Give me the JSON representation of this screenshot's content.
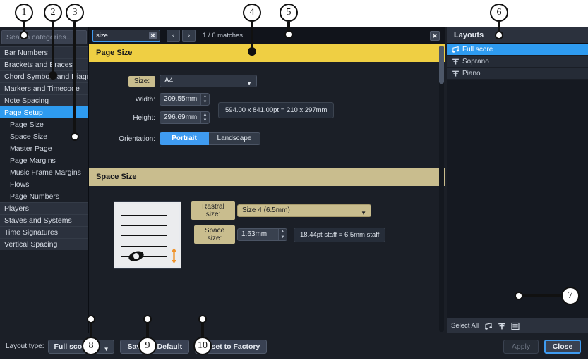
{
  "sidebar": {
    "search_placeholder": "Search categories...",
    "categories": [
      {
        "label": "Bar Numbers",
        "selected": false,
        "sub": false
      },
      {
        "label": "Brackets and Braces",
        "selected": false,
        "sub": false
      },
      {
        "label": "Chord Symbols and Diagrams",
        "selected": false,
        "sub": false
      },
      {
        "label": "Markers and Timecode",
        "selected": false,
        "sub": false
      },
      {
        "label": "Note Spacing",
        "selected": false,
        "sub": false
      },
      {
        "label": "Page Setup",
        "selected": true,
        "sub": false
      },
      {
        "label": "Page Size",
        "selected": false,
        "sub": true
      },
      {
        "label": "Space Size",
        "selected": false,
        "sub": true
      },
      {
        "label": "Master Page",
        "selected": false,
        "sub": true
      },
      {
        "label": "Page Margins",
        "selected": false,
        "sub": true
      },
      {
        "label": "Music Frame Margins",
        "selected": false,
        "sub": true
      },
      {
        "label": "Flows",
        "selected": false,
        "sub": true
      },
      {
        "label": "Page Numbers",
        "selected": false,
        "sub": true
      },
      {
        "label": "Players",
        "selected": false,
        "sub": false
      },
      {
        "label": "Staves and Systems",
        "selected": false,
        "sub": false
      },
      {
        "label": "Time Signatures",
        "selected": false,
        "sub": false
      },
      {
        "label": "Vertical Spacing",
        "selected": false,
        "sub": false
      }
    ]
  },
  "findbar": {
    "query": "size",
    "clear_label": "✖",
    "prev_label": "‹",
    "next_label": "›",
    "matches": "1 / 6 matches",
    "close_label": "✖"
  },
  "page_size": {
    "header": "Page Size",
    "size_label": "Size:",
    "size_value": "A4",
    "width_label": "Width:",
    "width_value": "209.55mm",
    "height_label": "Height:",
    "height_value": "296.69mm",
    "dimensions_info": "594.00 x 841.00pt = 210 x 297mm",
    "orientation_label": "Orientation:",
    "orientation_portrait": "Portrait",
    "orientation_landscape": "Landscape",
    "orientation_selected": "Portrait"
  },
  "space_size": {
    "header": "Space Size",
    "rastral_label": "Rastral size:",
    "rastral_value": "Size 4 (6.5mm)",
    "space_label": "Space size:",
    "space_value": "1.63mm",
    "staff_info": "18.44pt staff = 6.5mm staff",
    "thumbnail_icon": "staff-space-size-icon"
  },
  "layouts": {
    "title": "Layouts",
    "items": [
      {
        "label": "Full score",
        "icon": "score-icon",
        "selected": true
      },
      {
        "label": "Soprano",
        "icon": "player-icon",
        "selected": false
      },
      {
        "label": "Piano",
        "icon": "player-icon",
        "selected": false
      }
    ],
    "select_all_label": "Select All",
    "filters": [
      {
        "name": "filter-scores-icon"
      },
      {
        "name": "filter-players-icon"
      },
      {
        "name": "filter-custom-icon"
      }
    ]
  },
  "bottom": {
    "layout_type_label": "Layout type:",
    "layout_type_value": "Full score",
    "save_as_default": "Save as Default",
    "reset_to_factory": "Reset to Factory",
    "apply": "Apply",
    "close": "Close"
  },
  "callouts": [
    {
      "n": "1"
    },
    {
      "n": "2"
    },
    {
      "n": "3"
    },
    {
      "n": "4"
    },
    {
      "n": "5"
    },
    {
      "n": "6"
    },
    {
      "n": "7"
    },
    {
      "n": "8"
    },
    {
      "n": "9"
    },
    {
      "n": "10"
    }
  ],
  "colors": {
    "accent_blue": "#2e9bf0",
    "match_current": "#efcf43",
    "match_other": "#c9bd8e",
    "panel_bg": "#1b1f27",
    "arrow_orange": "#f0932b"
  }
}
